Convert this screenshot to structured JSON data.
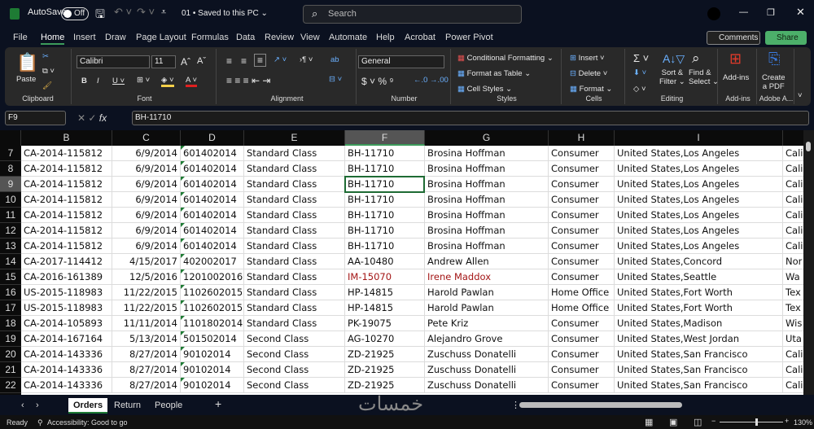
{
  "titlebar": {
    "autosave": "AutoSave",
    "toggle": "Off",
    "doc": "01 • Saved to this PC ⌄",
    "search_placeholder": "Search"
  },
  "tabs": [
    "File",
    "Home",
    "Insert",
    "Draw",
    "Page Layout",
    "Formulas",
    "Data",
    "Review",
    "View",
    "Automate",
    "Help",
    "Acrobat",
    "Power Pivot"
  ],
  "actions": {
    "comments": "Comments",
    "share": "Share"
  },
  "ribbon": {
    "clipboard": {
      "label": "Clipboard",
      "paste": "Paste"
    },
    "font": {
      "label": "Font",
      "name": "Calibri",
      "size": "11"
    },
    "alignment": {
      "label": "Alignment"
    },
    "number": {
      "label": "Number",
      "format": "General"
    },
    "styles": {
      "label": "Styles",
      "cond": "Conditional Formatting ⌄",
      "table": "Format as Table ⌄",
      "cell": "Cell Styles ⌄"
    },
    "cells": {
      "label": "Cells",
      "insert": "Insert",
      "delete": "Delete",
      "format": "Format ⌄"
    },
    "editing": {
      "label": "Editing",
      "sort": "Sort &",
      "sort2": "Filter ⌄",
      "find": "Find &",
      "find2": "Select ⌄"
    },
    "addins": {
      "label": "Add-ins",
      "btn": "Add-ins"
    },
    "adobe": {
      "label": "Adobe A...",
      "btn": "Create",
      "btn2": "a PDF"
    }
  },
  "formula": {
    "namebox": "F9",
    "value": "BH-11710"
  },
  "columns": [
    "B",
    "C",
    "D",
    "E",
    "F",
    "G",
    "H",
    "I",
    ""
  ],
  "selected": {
    "col": "F",
    "row": 9
  },
  "rows": [
    {
      "n": 7,
      "c": [
        "CA-2014-115812",
        "6/9/2014",
        "601402014",
        "Standard Class",
        "BH-11710",
        "Brosina Hoffman",
        "Consumer",
        "United States,Los Angeles",
        "Cali"
      ]
    },
    {
      "n": 8,
      "c": [
        "CA-2014-115812",
        "6/9/2014",
        "601402014",
        "Standard Class",
        "BH-11710",
        "Brosina Hoffman",
        "Consumer",
        "United States,Los Angeles",
        "Cali"
      ]
    },
    {
      "n": 9,
      "c": [
        "CA-2014-115812",
        "6/9/2014",
        "601402014",
        "Standard Class",
        "BH-11710",
        "Brosina Hoffman",
        "Consumer",
        "United States,Los Angeles",
        "Cali"
      ]
    },
    {
      "n": 10,
      "c": [
        "CA-2014-115812",
        "6/9/2014",
        "601402014",
        "Standard Class",
        "BH-11710",
        "Brosina Hoffman",
        "Consumer",
        "United States,Los Angeles",
        "Cali"
      ]
    },
    {
      "n": 11,
      "c": [
        "CA-2014-115812",
        "6/9/2014",
        "601402014",
        "Standard Class",
        "BH-11710",
        "Brosina Hoffman",
        "Consumer",
        "United States,Los Angeles",
        "Cali"
      ]
    },
    {
      "n": 12,
      "c": [
        "CA-2014-115812",
        "6/9/2014",
        "601402014",
        "Standard Class",
        "BH-11710",
        "Brosina Hoffman",
        "Consumer",
        "United States,Los Angeles",
        "Cali"
      ]
    },
    {
      "n": 13,
      "c": [
        "CA-2014-115812",
        "6/9/2014",
        "601402014",
        "Standard Class",
        "BH-11710",
        "Brosina Hoffman",
        "Consumer",
        "United States,Los Angeles",
        "Cali"
      ]
    },
    {
      "n": 14,
      "c": [
        "CA-2017-114412",
        "4/15/2017",
        "402002017",
        "Standard Class",
        "AA-10480",
        "Andrew Allen",
        "Consumer",
        "United States,Concord",
        "Nor"
      ]
    },
    {
      "n": 15,
      "c": [
        "CA-2016-161389",
        "12/5/2016",
        "1201002016",
        "Standard Class",
        "IM-15070",
        "Irene Maddox",
        "Consumer",
        "United States,Seattle",
        "Wa"
      ]
    },
    {
      "n": 16,
      "c": [
        "US-2015-118983",
        "11/22/2015",
        "1102602015",
        "Standard Class",
        "HP-14815",
        "Harold Pawlan",
        "Home Office",
        "United States,Fort Worth",
        "Tex"
      ]
    },
    {
      "n": 17,
      "c": [
        "US-2015-118983",
        "11/22/2015",
        "1102602015",
        "Standard Class",
        "HP-14815",
        "Harold Pawlan",
        "Home Office",
        "United States,Fort Worth",
        "Tex"
      ]
    },
    {
      "n": 18,
      "c": [
        "CA-2014-105893",
        "11/11/2014",
        "1101802014",
        "Standard Class",
        "PK-19075",
        "Pete Kriz",
        "Consumer",
        "United States,Madison",
        "Wis"
      ]
    },
    {
      "n": 19,
      "c": [
        "CA-2014-167164",
        "5/13/2014",
        "501502014",
        "Second Class",
        "AG-10270",
        "Alejandro Grove",
        "Consumer",
        "United States,West Jordan",
        "Uta"
      ]
    },
    {
      "n": 20,
      "c": [
        "CA-2014-143336",
        "8/27/2014",
        "90102014",
        "Second Class",
        "ZD-21925",
        "Zuschuss Donatelli",
        "Consumer",
        "United States,San Francisco",
        "Cali"
      ]
    },
    {
      "n": 21,
      "c": [
        "CA-2014-143336",
        "8/27/2014",
        "90102014",
        "Second Class",
        "ZD-21925",
        "Zuschuss Donatelli",
        "Consumer",
        "United States,San Francisco",
        "Cali"
      ]
    },
    {
      "n": 22,
      "c": [
        "CA-2014-143336",
        "8/27/2014",
        "90102014",
        "Second Class",
        "ZD-21925",
        "Zuschuss Donatelli",
        "Consumer",
        "United States,San Francisco",
        "Cali"
      ]
    }
  ],
  "red_row": 15,
  "sheets": [
    "Orders",
    "Return",
    "People"
  ],
  "active_sheet": "Orders",
  "watermark": "خمسات",
  "status": {
    "ready": "Ready",
    "accessibility": "Accessibility: Good to go",
    "zoom": "130%"
  },
  "colors": {
    "accent": "#3c9b5b",
    "share": "#4caf6a",
    "selection": "#1e6b34"
  }
}
